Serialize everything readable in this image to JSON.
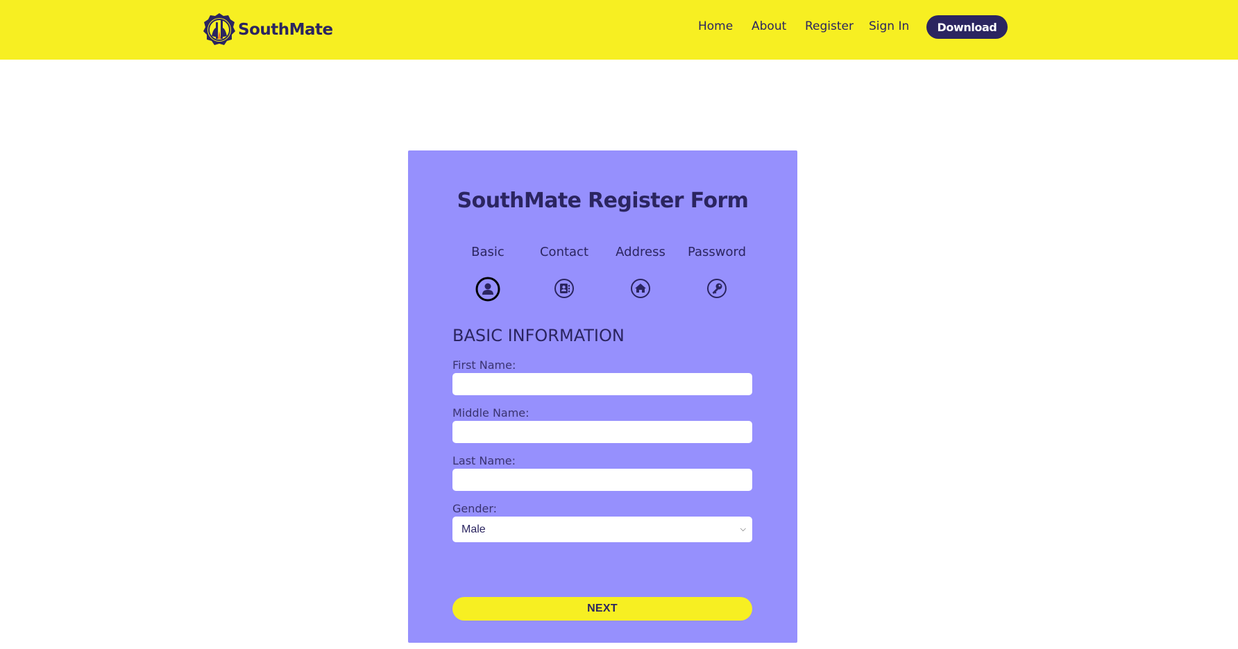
{
  "colors": {
    "header_bg": "#f7ef22",
    "brand_dark": "#2b2560",
    "card_bg": "#9690fd",
    "next_button_bg": "#f7ef22"
  },
  "header": {
    "brand": "SouthMate",
    "nav": {
      "home": "Home",
      "about": "About",
      "register": "Register",
      "sign_in": "Sign In"
    },
    "download_label": "Download"
  },
  "form": {
    "title": "SouthMate Register Form",
    "steps": [
      {
        "label": "Basic",
        "icon": "user-icon",
        "active": true
      },
      {
        "label": "Contact",
        "icon": "contact-book-icon",
        "active": false
      },
      {
        "label": "Address",
        "icon": "home-icon",
        "active": false
      },
      {
        "label": "Password",
        "icon": "key-icon",
        "active": false
      }
    ],
    "section_title": "BASIC INFORMATION",
    "fields": {
      "first_name": {
        "label": "First Name:",
        "value": ""
      },
      "middle_name": {
        "label": "Middle Name:",
        "value": ""
      },
      "last_name": {
        "label": "Last Name:",
        "value": ""
      },
      "gender": {
        "label": "Gender:",
        "value": "Male"
      }
    },
    "next_label": "NEXT"
  }
}
